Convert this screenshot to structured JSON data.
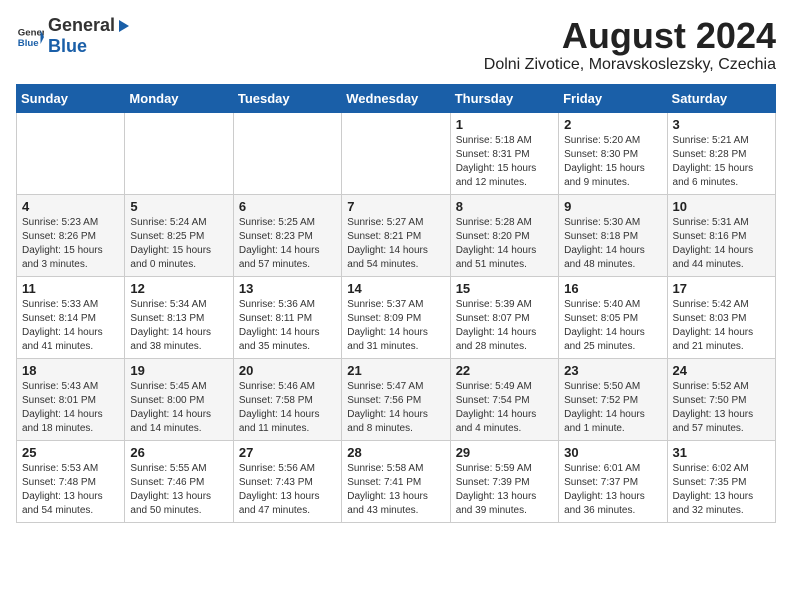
{
  "logo": {
    "general": "General",
    "blue": "Blue"
  },
  "title": "August 2024",
  "subtitle": "Dolni Zivotice, Moravskoslezsky, Czechia",
  "days_of_week": [
    "Sunday",
    "Monday",
    "Tuesday",
    "Wednesday",
    "Thursday",
    "Friday",
    "Saturday"
  ],
  "weeks": [
    [
      {
        "day": "",
        "detail": ""
      },
      {
        "day": "",
        "detail": ""
      },
      {
        "day": "",
        "detail": ""
      },
      {
        "day": "",
        "detail": ""
      },
      {
        "day": "1",
        "detail": "Sunrise: 5:18 AM\nSunset: 8:31 PM\nDaylight: 15 hours\nand 12 minutes."
      },
      {
        "day": "2",
        "detail": "Sunrise: 5:20 AM\nSunset: 8:30 PM\nDaylight: 15 hours\nand 9 minutes."
      },
      {
        "day": "3",
        "detail": "Sunrise: 5:21 AM\nSunset: 8:28 PM\nDaylight: 15 hours\nand 6 minutes."
      }
    ],
    [
      {
        "day": "4",
        "detail": "Sunrise: 5:23 AM\nSunset: 8:26 PM\nDaylight: 15 hours\nand 3 minutes."
      },
      {
        "day": "5",
        "detail": "Sunrise: 5:24 AM\nSunset: 8:25 PM\nDaylight: 15 hours\nand 0 minutes."
      },
      {
        "day": "6",
        "detail": "Sunrise: 5:25 AM\nSunset: 8:23 PM\nDaylight: 14 hours\nand 57 minutes."
      },
      {
        "day": "7",
        "detail": "Sunrise: 5:27 AM\nSunset: 8:21 PM\nDaylight: 14 hours\nand 54 minutes."
      },
      {
        "day": "8",
        "detail": "Sunrise: 5:28 AM\nSunset: 8:20 PM\nDaylight: 14 hours\nand 51 minutes."
      },
      {
        "day": "9",
        "detail": "Sunrise: 5:30 AM\nSunset: 8:18 PM\nDaylight: 14 hours\nand 48 minutes."
      },
      {
        "day": "10",
        "detail": "Sunrise: 5:31 AM\nSunset: 8:16 PM\nDaylight: 14 hours\nand 44 minutes."
      }
    ],
    [
      {
        "day": "11",
        "detail": "Sunrise: 5:33 AM\nSunset: 8:14 PM\nDaylight: 14 hours\nand 41 minutes."
      },
      {
        "day": "12",
        "detail": "Sunrise: 5:34 AM\nSunset: 8:13 PM\nDaylight: 14 hours\nand 38 minutes."
      },
      {
        "day": "13",
        "detail": "Sunrise: 5:36 AM\nSunset: 8:11 PM\nDaylight: 14 hours\nand 35 minutes."
      },
      {
        "day": "14",
        "detail": "Sunrise: 5:37 AM\nSunset: 8:09 PM\nDaylight: 14 hours\nand 31 minutes."
      },
      {
        "day": "15",
        "detail": "Sunrise: 5:39 AM\nSunset: 8:07 PM\nDaylight: 14 hours\nand 28 minutes."
      },
      {
        "day": "16",
        "detail": "Sunrise: 5:40 AM\nSunset: 8:05 PM\nDaylight: 14 hours\nand 25 minutes."
      },
      {
        "day": "17",
        "detail": "Sunrise: 5:42 AM\nSunset: 8:03 PM\nDaylight: 14 hours\nand 21 minutes."
      }
    ],
    [
      {
        "day": "18",
        "detail": "Sunrise: 5:43 AM\nSunset: 8:01 PM\nDaylight: 14 hours\nand 18 minutes."
      },
      {
        "day": "19",
        "detail": "Sunrise: 5:45 AM\nSunset: 8:00 PM\nDaylight: 14 hours\nand 14 minutes."
      },
      {
        "day": "20",
        "detail": "Sunrise: 5:46 AM\nSunset: 7:58 PM\nDaylight: 14 hours\nand 11 minutes."
      },
      {
        "day": "21",
        "detail": "Sunrise: 5:47 AM\nSunset: 7:56 PM\nDaylight: 14 hours\nand 8 minutes."
      },
      {
        "day": "22",
        "detail": "Sunrise: 5:49 AM\nSunset: 7:54 PM\nDaylight: 14 hours\nand 4 minutes."
      },
      {
        "day": "23",
        "detail": "Sunrise: 5:50 AM\nSunset: 7:52 PM\nDaylight: 14 hours\nand 1 minute."
      },
      {
        "day": "24",
        "detail": "Sunrise: 5:52 AM\nSunset: 7:50 PM\nDaylight: 13 hours\nand 57 minutes."
      }
    ],
    [
      {
        "day": "25",
        "detail": "Sunrise: 5:53 AM\nSunset: 7:48 PM\nDaylight: 13 hours\nand 54 minutes."
      },
      {
        "day": "26",
        "detail": "Sunrise: 5:55 AM\nSunset: 7:46 PM\nDaylight: 13 hours\nand 50 minutes."
      },
      {
        "day": "27",
        "detail": "Sunrise: 5:56 AM\nSunset: 7:43 PM\nDaylight: 13 hours\nand 47 minutes."
      },
      {
        "day": "28",
        "detail": "Sunrise: 5:58 AM\nSunset: 7:41 PM\nDaylight: 13 hours\nand 43 minutes."
      },
      {
        "day": "29",
        "detail": "Sunrise: 5:59 AM\nSunset: 7:39 PM\nDaylight: 13 hours\nand 39 minutes."
      },
      {
        "day": "30",
        "detail": "Sunrise: 6:01 AM\nSunset: 7:37 PM\nDaylight: 13 hours\nand 36 minutes."
      },
      {
        "day": "31",
        "detail": "Sunrise: 6:02 AM\nSunset: 7:35 PM\nDaylight: 13 hours\nand 32 minutes."
      }
    ]
  ]
}
